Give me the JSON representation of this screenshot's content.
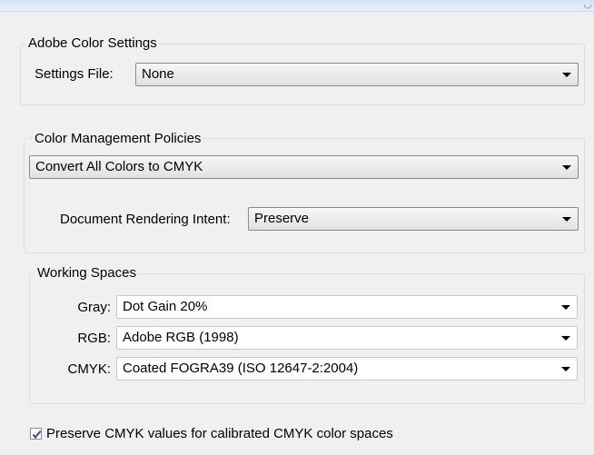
{
  "adobe_color_settings": {
    "group_title": "Adobe Color Settings",
    "settings_file_label": "Settings File:",
    "settings_file_value": "None"
  },
  "color_management_policies": {
    "group_title": "Color Management Policies",
    "policy_value": "Convert All Colors to CMYK",
    "rendering_intent_label": "Document Rendering Intent:",
    "rendering_intent_value": "Preserve"
  },
  "working_spaces": {
    "group_title": "Working Spaces",
    "gray_label": "Gray:",
    "gray_value": "Dot Gain 20%",
    "rgb_label": "RGB:",
    "rgb_value": "Adobe RGB (1998)",
    "cmyk_label": "CMYK:",
    "cmyk_value": "Coated FOGRA39 (ISO 12647-2:2004)"
  },
  "preserve_cmyk": {
    "label": "Preserve CMYK values for calibrated CMYK color spaces",
    "checked": true
  },
  "colors": {
    "panel_background": "#f0f0f0",
    "group_border": "#d5dfe5",
    "checkmark": "#2b4f8a"
  }
}
